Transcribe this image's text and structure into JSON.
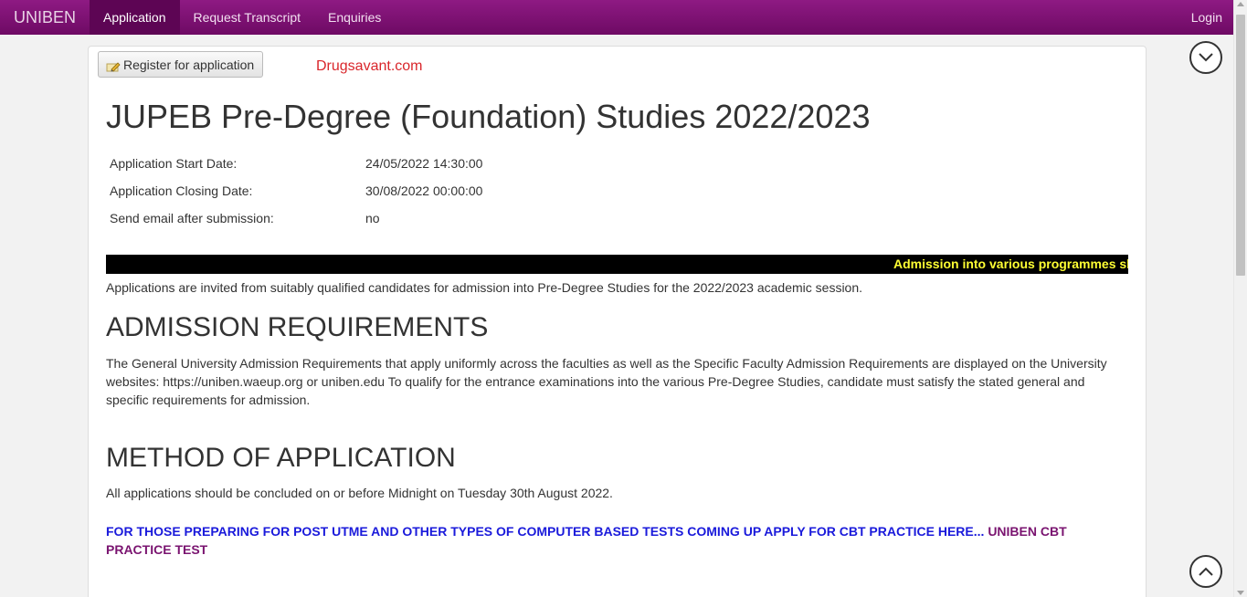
{
  "navbar": {
    "brand": "UNIBEN",
    "items": [
      {
        "label": "Application",
        "active": true
      },
      {
        "label": "Request Transcript",
        "active": false
      },
      {
        "label": "Enquiries",
        "active": false
      }
    ],
    "login": "Login"
  },
  "panel": {
    "register_button": "Register for application",
    "watermark": "Drugsavant.com",
    "title": "JUPEB Pre-Degree (Foundation) Studies 2022/2023",
    "info": [
      {
        "label": "Application Start Date:",
        "value": "24/05/2022 14:30:00"
      },
      {
        "label": "Application Closing Date:",
        "value": "30/08/2022 00:00:00"
      },
      {
        "label": "Send email after submission:",
        "value": "no"
      }
    ],
    "ticker": "Admission into various programmes shall",
    "intro": "Applications are invited from suitably qualified candidates for admission into Pre-Degree Studies for the 2022/2023 academic session.",
    "requirements_heading": "ADMISSION REQUIREMENTS",
    "requirements_text": "The General University Admission Requirements that apply uniformly across the faculties as well as the Specific Faculty Admission Requirements are displayed on the University websites: https://uniben.waeup.org or uniben.edu To qualify for the entrance examinations into the various Pre-Degree Studies, candidate must satisfy the stated general and specific requirements for admission.",
    "method_heading": "METHOD OF APPLICATION",
    "method_text": "All applications should be concluded on or before Midnight on Tuesday 30th August 2022.",
    "cbt_text": "FOR THOSE PREPARING FOR POST UTME AND OTHER TYPES OF COMPUTER BASED TESTS COMING UP APPLY FOR CBT PRACTICE HERE...",
    "cbt_link": "UNIBEN CBT PRACTICE TEST"
  },
  "colors": {
    "navbar": "#7d0f73",
    "navbar_active": "#5d0554",
    "watermark": "#d9262b",
    "ticker_bg": "#000000",
    "ticker_text": "#ffff33",
    "cbt_blue": "#1a1adb",
    "cbt_link": "#7a1470"
  },
  "icons": {
    "register": "pencil-icon",
    "scroll_down": "chevron-down-icon",
    "scroll_up": "chevron-up-icon"
  }
}
